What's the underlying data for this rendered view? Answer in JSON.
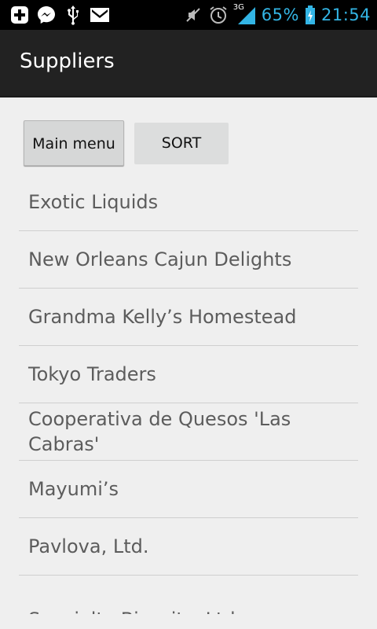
{
  "status_bar": {
    "battery": "65%",
    "time": "21:54",
    "network": "3G",
    "icons": [
      "plus-icon",
      "messenger-icon",
      "usb-icon",
      "gmail-icon",
      "mute-icon",
      "alarm-icon",
      "signal-icon",
      "battery-icon"
    ]
  },
  "action_bar": {
    "title": "Suppliers"
  },
  "buttons": {
    "main_menu": "Main menu",
    "sort": "SORT"
  },
  "suppliers": [
    "Exotic Liquids",
    "New Orleans Cajun Delights",
    "Grandma Kelly’s Homestead",
    "Tokyo Traders",
    "Cooperativa de Quesos 'Las Cabras'",
    "Mayumi’s",
    "Pavlova, Ltd.",
    "Specialty Biscuits, Ltd."
  ],
  "colors": {
    "accent": "#33b5e5",
    "background": "#efefef",
    "action_bar": "#222222",
    "list_text": "#5c5c5c"
  }
}
